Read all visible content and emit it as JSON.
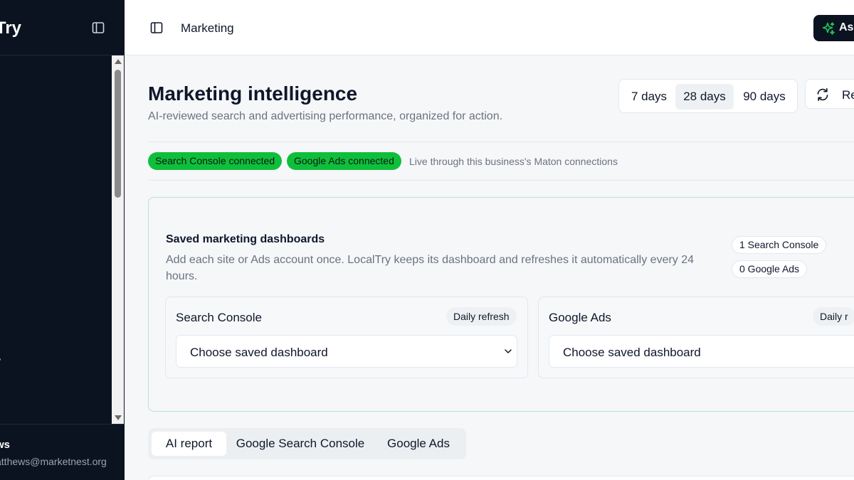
{
  "sidebar": {
    "brand": "Try",
    "user": {
      "name": "ws",
      "email": "atthews@marketnest.org"
    }
  },
  "topbar": {
    "title": "Marketing",
    "ask_label": "As"
  },
  "page": {
    "title": "Marketing intelligence",
    "subtitle": "AI-reviewed search and advertising performance, organized for action."
  },
  "range": {
    "options": [
      "7 days",
      "28 days",
      "90 days"
    ],
    "selected": "28 days"
  },
  "refresh_label": "Re",
  "status": {
    "pills": [
      "Search Console connected",
      "Google Ads connected"
    ],
    "note": "Live through this business's Maton connections"
  },
  "dashboards": {
    "title": "Saved marketing dashboards",
    "description": "Add each site or Ads account once. LocalTry keeps its dashboard and refreshes it automatically every 24 hours.",
    "counts": [
      "1 Search Console",
      "0 Google Ads"
    ],
    "cards": [
      {
        "title": "Search Console",
        "badge": "Daily refresh",
        "select_value": "Choose saved dashboard"
      },
      {
        "title": "Google Ads",
        "badge": "Daily r",
        "select_value": "Choose saved dashboard"
      }
    ]
  },
  "tabs": {
    "items": [
      "AI report",
      "Google Search Console",
      "Google Ads"
    ],
    "active": "AI report"
  },
  "colors": {
    "sidebar_bg": "#0b1220",
    "connected_green": "#0fbf3c",
    "accent_green_icon": "#22c55e",
    "card_border_green": "#b9e5c3"
  },
  "icons": {
    "sidebar_toggle": "panel-left-icon",
    "ask": "sparkles-icon",
    "refresh": "refresh-cw-icon",
    "select": "chevron-down-icon"
  }
}
